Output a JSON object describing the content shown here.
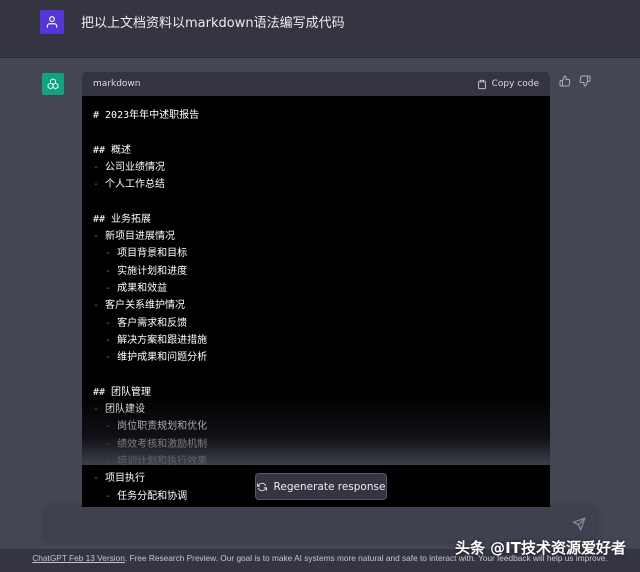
{
  "user_message": {
    "text": "把以上文档资料以markdown语法编写成代码"
  },
  "code_block": {
    "language": "markdown",
    "copy_label": "Copy code",
    "lines": [
      {
        "prefix": "",
        "text": "# 2023年年中述职报告"
      },
      {
        "prefix": "",
        "text": ""
      },
      {
        "prefix": "",
        "text": "## 概述"
      },
      {
        "prefix": "- ",
        "text": "公司业绩情况"
      },
      {
        "prefix": "- ",
        "text": "个人工作总结"
      },
      {
        "prefix": "",
        "text": ""
      },
      {
        "prefix": "",
        "text": "## 业务拓展"
      },
      {
        "prefix": "- ",
        "text": "新项目进展情况"
      },
      {
        "prefix": "  - ",
        "text": "项目背景和目标"
      },
      {
        "prefix": "  - ",
        "text": "实施计划和进度"
      },
      {
        "prefix": "  - ",
        "text": "成果和效益"
      },
      {
        "prefix": "- ",
        "text": "客户关系维护情况"
      },
      {
        "prefix": "  - ",
        "text": "客户需求和反馈"
      },
      {
        "prefix": "  - ",
        "text": "解决方案和跟进措施"
      },
      {
        "prefix": "  - ",
        "text": "维护成果和问题分析"
      },
      {
        "prefix": "",
        "text": ""
      },
      {
        "prefix": "",
        "text": "## 团队管理"
      },
      {
        "prefix": "- ",
        "text": "团队建设"
      },
      {
        "prefix": "  - ",
        "text": "岗位职责规划和优化"
      },
      {
        "prefix": "  - ",
        "text": "绩效考核和激励机制"
      },
      {
        "prefix": "  - ",
        "text": "培训计划和执行效果"
      },
      {
        "prefix": "- ",
        "text": "项目执行"
      },
      {
        "prefix": "  - ",
        "text": "任务分配和协调"
      }
    ]
  },
  "actions": {
    "regenerate_label": "Regenerate response"
  },
  "composer": {
    "placeholder": ""
  },
  "footer": {
    "link_text": "ChatGPT Feb 13 Version",
    "text": ". Free Research Preview. Our goal is to make AI systems more natural and safe to interact with. Your feedback will help us improve."
  },
  "watermark": {
    "text": "头条 @IT技术资源爱好者"
  },
  "colors": {
    "background": "#343541",
    "assistant_background": "#444654",
    "user_avatar": "#5436da",
    "gpt_avatar": "#10a37f",
    "code_background": "#000000",
    "list_dash": "#e64545"
  },
  "icons": {
    "user_avatar": "person-icon",
    "assistant_avatar": "openai-logo-icon",
    "copy": "clipboard-icon",
    "thumbs_up": "thumbs-up-icon",
    "thumbs_down": "thumbs-down-icon",
    "regenerate": "refresh-icon",
    "send": "paper-plane-icon"
  }
}
